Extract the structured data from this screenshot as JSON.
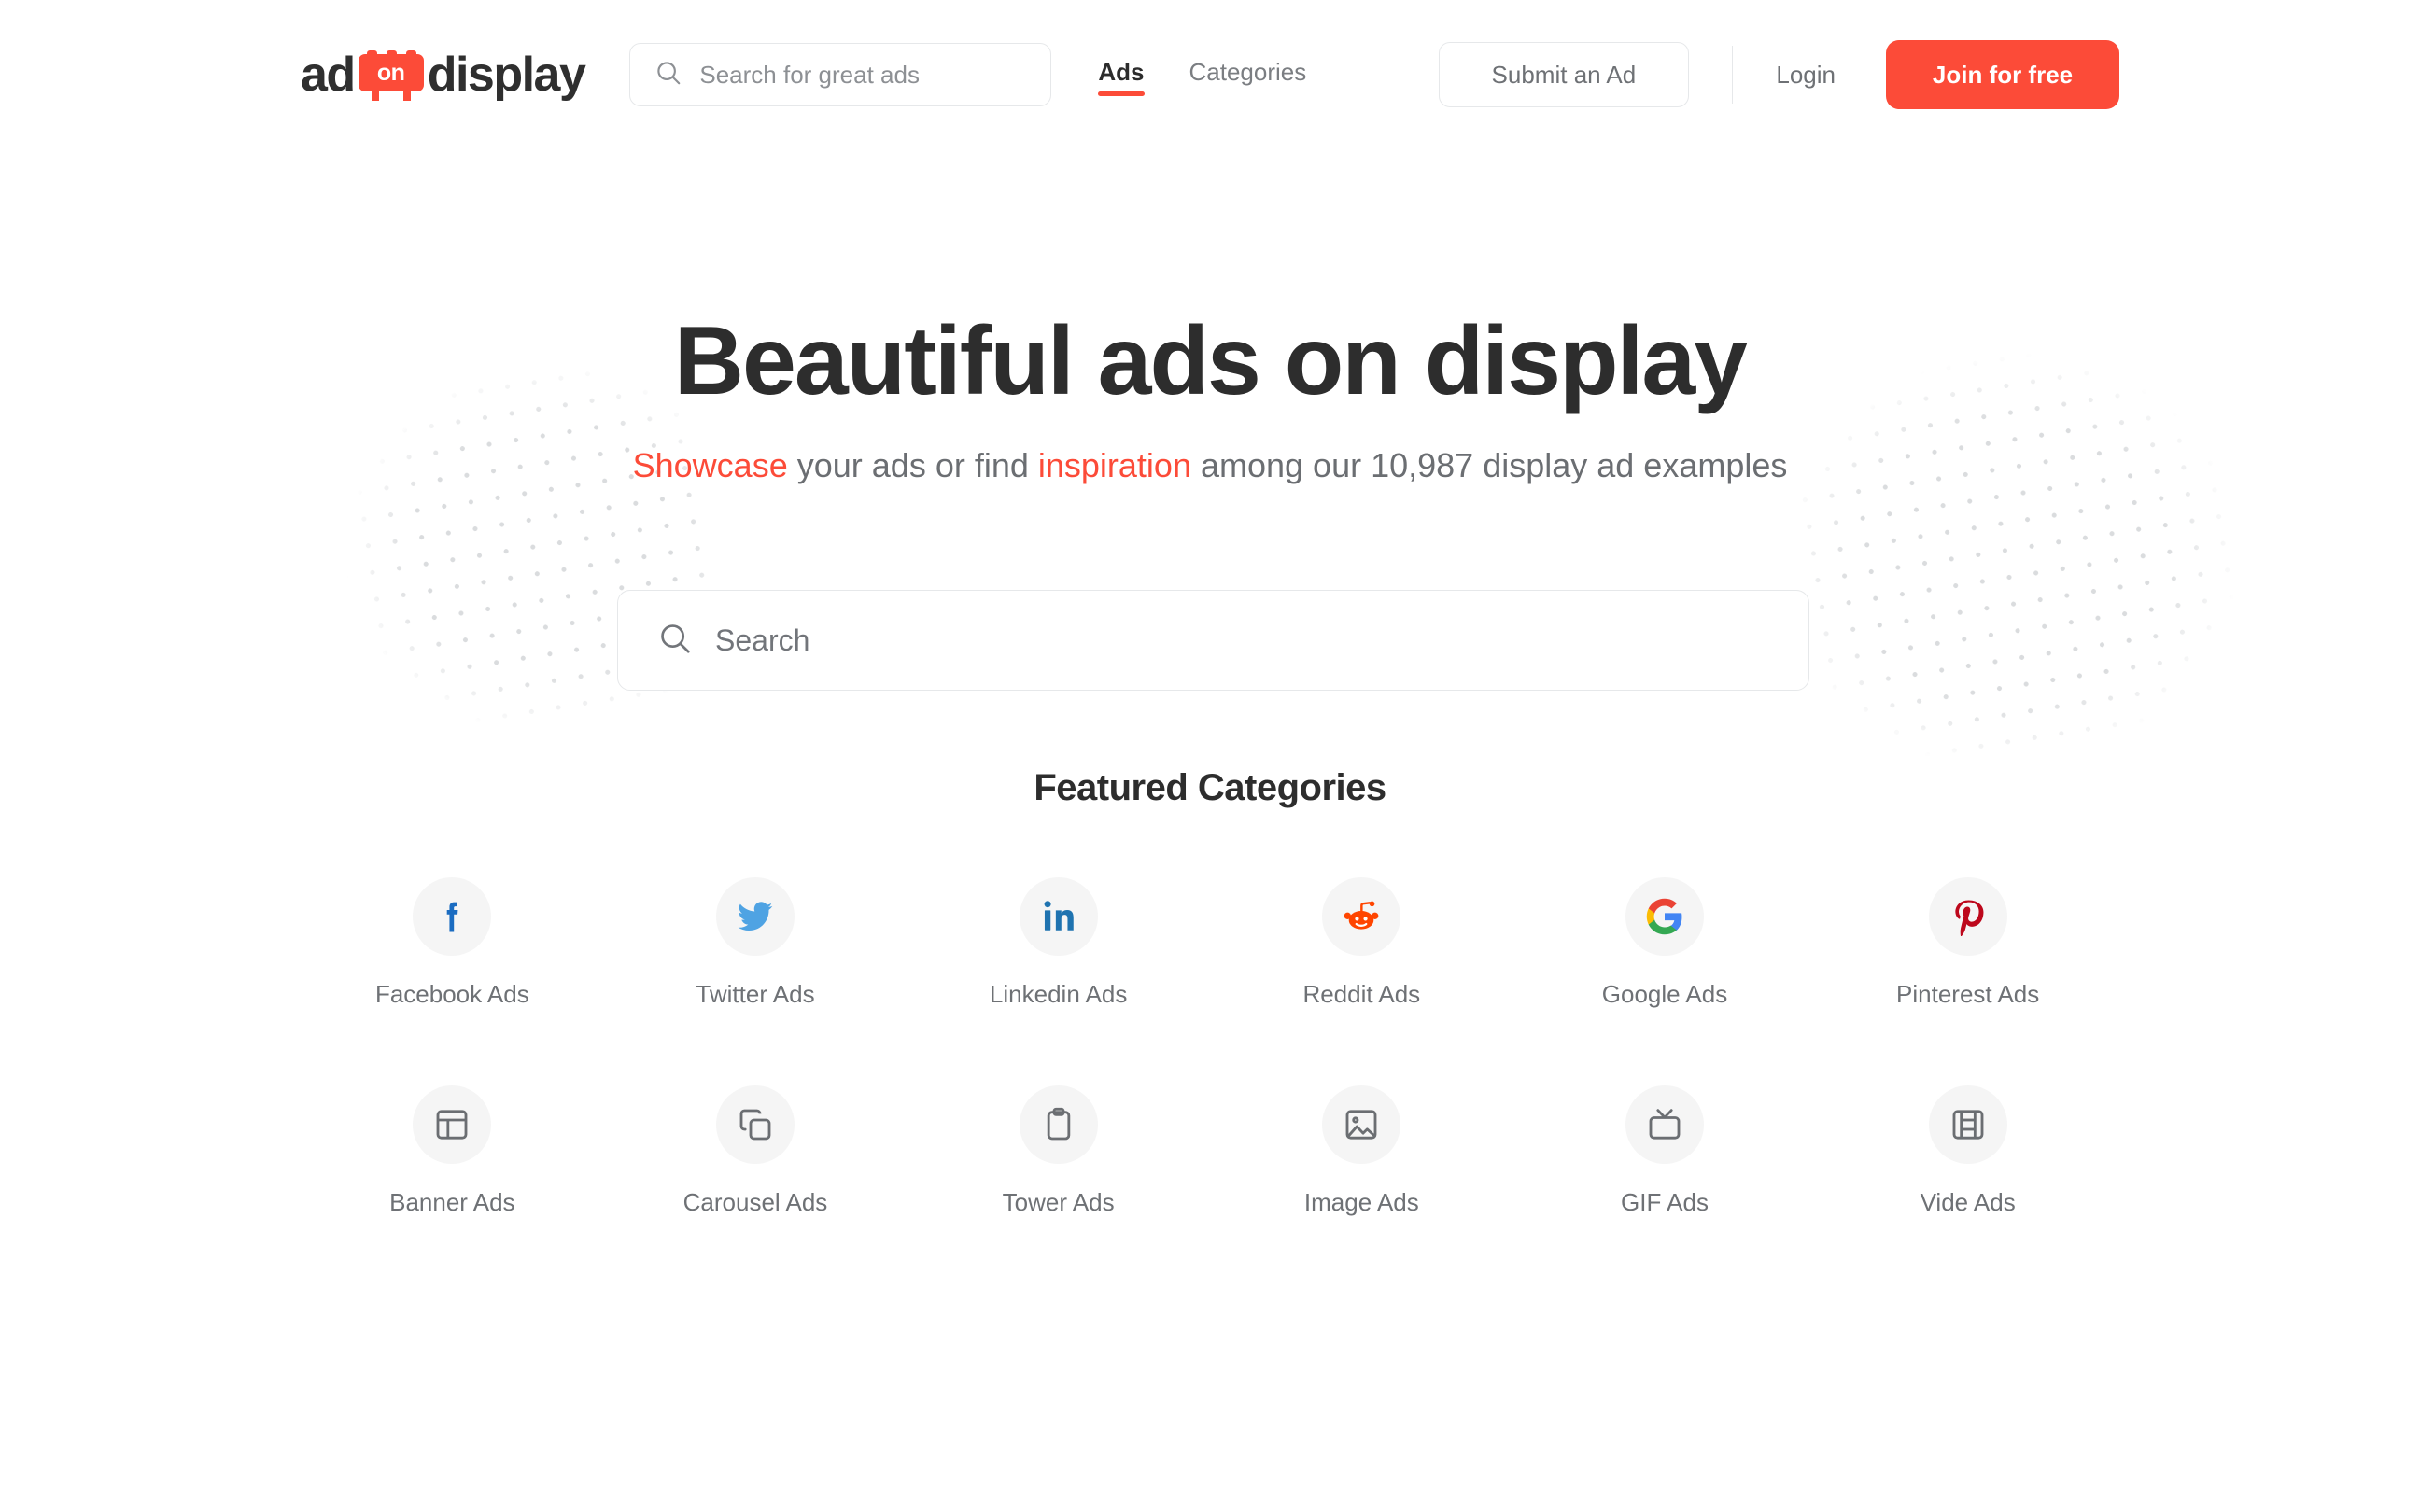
{
  "brand": {
    "name_part1": "ad",
    "mark_text": "on",
    "name_part2": "display",
    "accent_color": "#FC4B38"
  },
  "header": {
    "search": {
      "placeholder": "Search for great ads",
      "value": "",
      "icon": "search-icon"
    },
    "nav": [
      {
        "label": "Ads",
        "active": true
      },
      {
        "label": "Categories",
        "active": false
      }
    ],
    "submit_label": "Submit an Ad",
    "login_label": "Login",
    "join_label": "Join for free"
  },
  "hero": {
    "title": "Beautiful ads on display",
    "sub_accent1": "Showcase",
    "sub_mid1": " your ads or find ",
    "sub_accent2": "inspiration",
    "sub_mid2": " among our 10,987 display ad examples",
    "count": "10,987",
    "search": {
      "placeholder": "Search",
      "value": "",
      "icon": "search-icon"
    }
  },
  "categories": {
    "title": "Featured Categories",
    "items": [
      {
        "label": "Facebook Ads",
        "icon": "facebook-icon",
        "color": "#1B6CC1"
      },
      {
        "label": "Twitter Ads",
        "icon": "twitter-icon",
        "color": "#4FA3E3"
      },
      {
        "label": "Linkedin Ads",
        "icon": "linkedin-icon",
        "color": "#1F73B0"
      },
      {
        "label": "Reddit Ads",
        "icon": "reddit-icon",
        "color": "#FF4500"
      },
      {
        "label": "Google Ads",
        "icon": "google-icon",
        "color": "#4285F4"
      },
      {
        "label": "Pinterest Ads",
        "icon": "pinterest-icon",
        "color": "#BD081C"
      },
      {
        "label": "Banner Ads",
        "icon": "layout-panel-icon",
        "color": "#6b6e72"
      },
      {
        "label": "Carousel Ads",
        "icon": "copy-squares-icon",
        "color": "#6b6e72"
      },
      {
        "label": "Tower Ads",
        "icon": "clipboard-icon",
        "color": "#6b6e72"
      },
      {
        "label": "Image Ads",
        "icon": "image-icon",
        "color": "#6b6e72"
      },
      {
        "label": "GIF Ads",
        "icon": "tv-icon",
        "color": "#6b6e72"
      },
      {
        "label": "Vide Ads",
        "icon": "film-strip-icon",
        "color": "#6b6e72"
      }
    ]
  }
}
